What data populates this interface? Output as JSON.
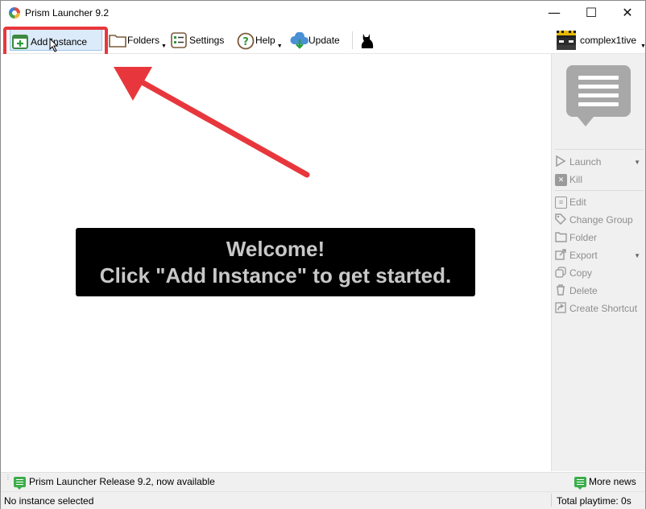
{
  "window": {
    "title": "Prism Launcher 9.2"
  },
  "titlebar_buttons": {
    "minimize": "—",
    "maximize": "☐",
    "close": "✕"
  },
  "toolbar": {
    "add_instance": "Add Instance",
    "folders": "Folders",
    "settings": "Settings",
    "help": "Help",
    "update": "Update",
    "account": "complex1tive"
  },
  "welcome": {
    "line1": "Welcome!",
    "line2": "Click \"Add Instance\" to get started."
  },
  "sidebar": {
    "items": [
      {
        "label": "Launch",
        "icon": "play-icon"
      },
      {
        "label": "Kill",
        "icon": "kill-icon"
      },
      {
        "label": "Edit",
        "icon": "edit-icon"
      },
      {
        "label": "Change Group",
        "icon": "tag-icon"
      },
      {
        "label": "Folder",
        "icon": "folder-icon"
      },
      {
        "label": "Export",
        "icon": "export-icon"
      },
      {
        "label": "Copy",
        "icon": "copy-icon"
      },
      {
        "label": "Delete",
        "icon": "trash-icon"
      },
      {
        "label": "Create Shortcut",
        "icon": "shortcut-icon"
      }
    ]
  },
  "status": {
    "news": "Prism Launcher Release 9.2, now available",
    "more_news": "More news",
    "instance": "No instance selected",
    "playtime": "Total playtime: 0s"
  },
  "colors": {
    "highlight": "#e8373c",
    "arrow": "#e8373c",
    "news_green": "#3cae4b",
    "welcome_bg": "#000000"
  }
}
